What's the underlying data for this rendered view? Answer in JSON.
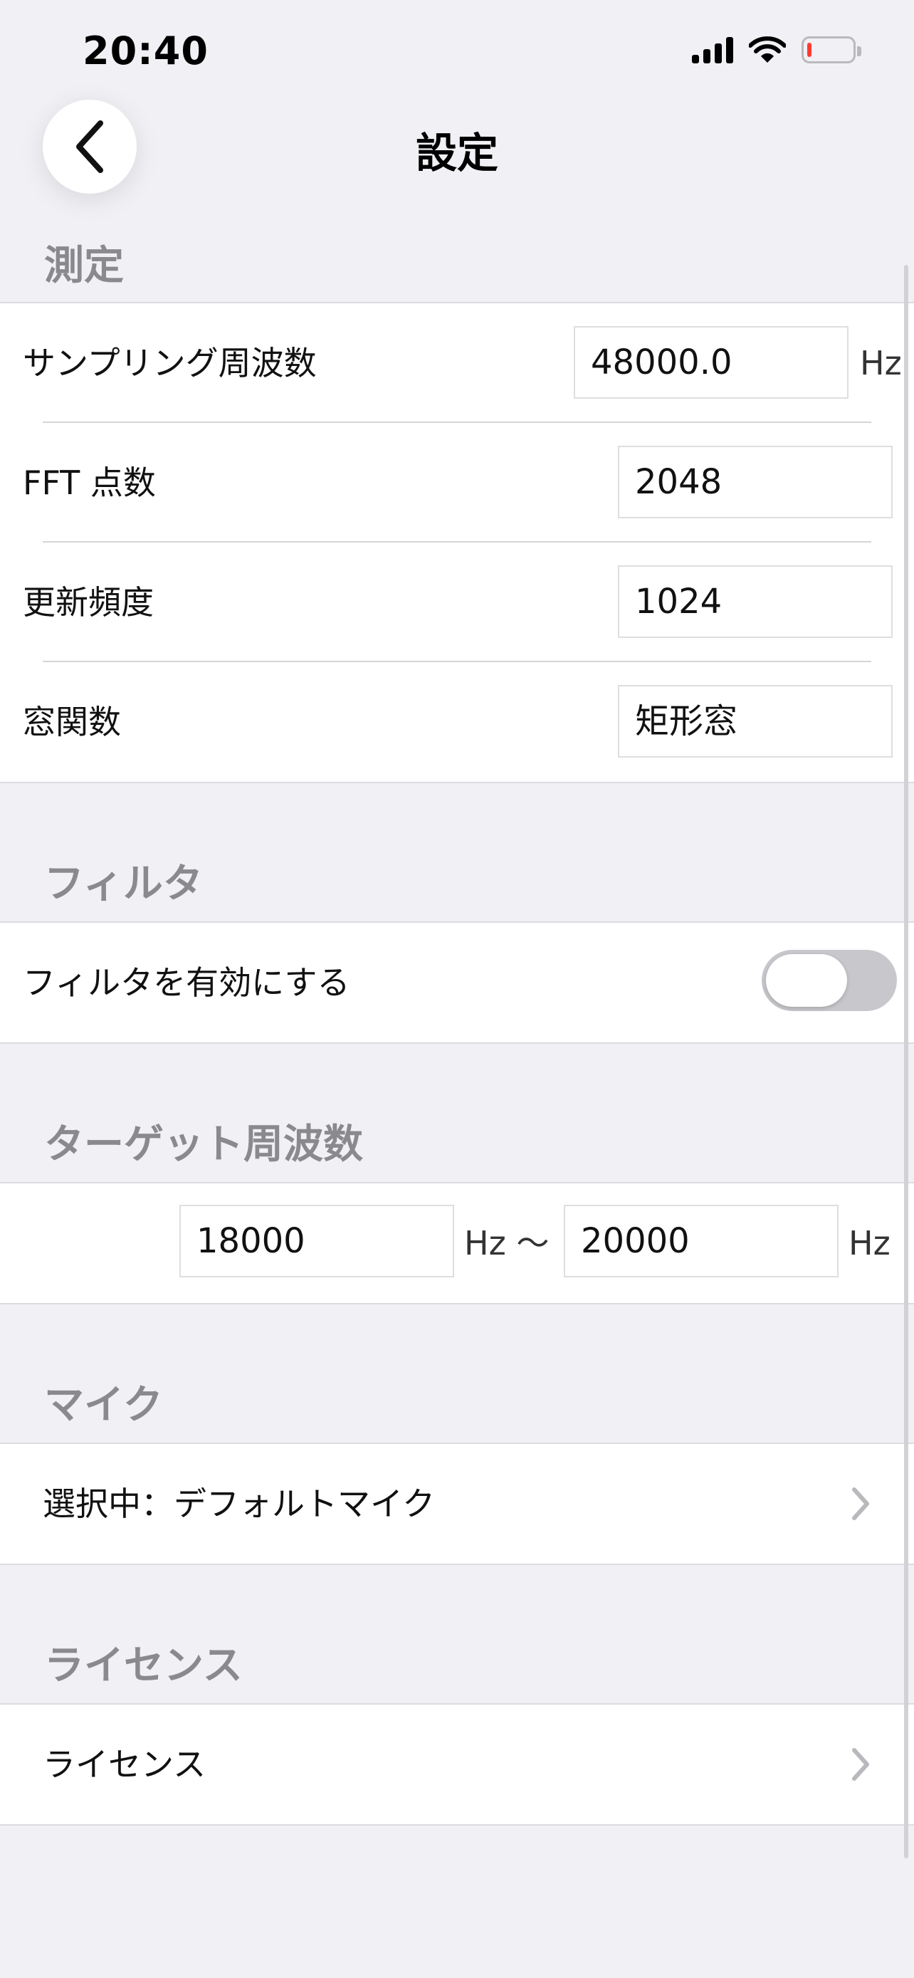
{
  "status_bar": {
    "time": "20:40",
    "icons": [
      "cellular-signal-icon",
      "wifi-icon",
      "battery-low-icon"
    ]
  },
  "nav": {
    "title": "設定",
    "back_icon": "chevron-left-icon"
  },
  "sections": {
    "measurement": {
      "header": "測定",
      "sampling_rate": {
        "label": "サンプリング周波数",
        "value": "48000.0",
        "unit": "Hz"
      },
      "fft_points": {
        "label": "FFT 点数",
        "value": "2048"
      },
      "update_rate": {
        "label": "更新頻度",
        "value": "1024"
      },
      "window_function": {
        "label": "窓関数",
        "value": "矩形窓"
      }
    },
    "filter": {
      "header": "フィルタ",
      "enable": {
        "label": "フィルタを有効にする",
        "on": false
      }
    },
    "target_frequency": {
      "header": "ターゲット周波数",
      "min_value": "18000",
      "min_unit": "Hz 〜",
      "max_value": "20000",
      "max_unit": "Hz"
    },
    "mic": {
      "header": "マイク",
      "selected_label": "選択中：デフォルトマイク"
    },
    "license": {
      "header": "ライセンス",
      "item_label": "ライセンス"
    }
  },
  "colors": {
    "background": "#f0f0f5",
    "section_header": "#8a8a8e",
    "toggle_off": "#c8c8cc",
    "battery_low": "#ff3b30"
  }
}
